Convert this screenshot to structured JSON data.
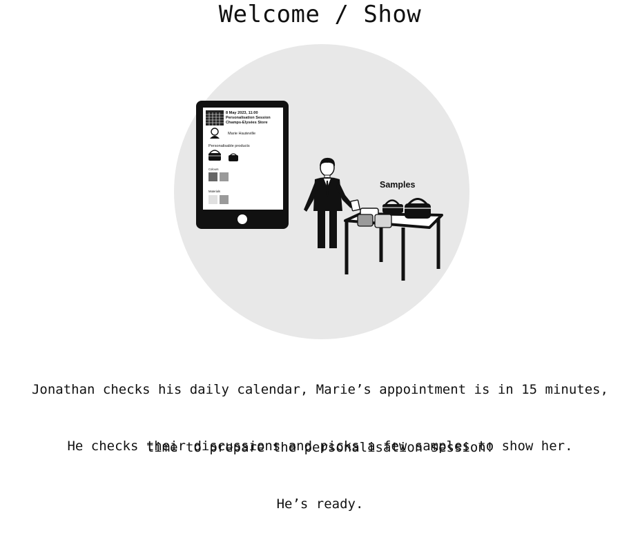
{
  "header": {
    "title": "Welcome / Show"
  },
  "tablet": {
    "appointment_line1": "8 May 2023, 11:00",
    "appointment_line2": "Personalisation Session",
    "appointment_line3": "Champs-Elysées Store",
    "client_name": "Marie Hauteville",
    "products_label": "Personalisable products",
    "colours_label": "Colours",
    "materials_label": "Materials"
  },
  "scene": {
    "samples_label": "Samples"
  },
  "caption": {
    "paragraph1_line1": "Jonathan checks his daily calendar, Marie’s appointment is in 15 minutes,",
    "paragraph1_line2": "time to prepare the personalisation session!",
    "paragraph2_line1": "He checks their discussions and picks a few samples to show her.",
    "paragraph2_line2": "He’s ready."
  },
  "colors": {
    "circle_bg": "#e8e8e8",
    "ink": "#111111",
    "swatch_dark": "#666666",
    "swatch_mid": "#9a9a9a",
    "swatch_light": "#d8d8d8"
  }
}
